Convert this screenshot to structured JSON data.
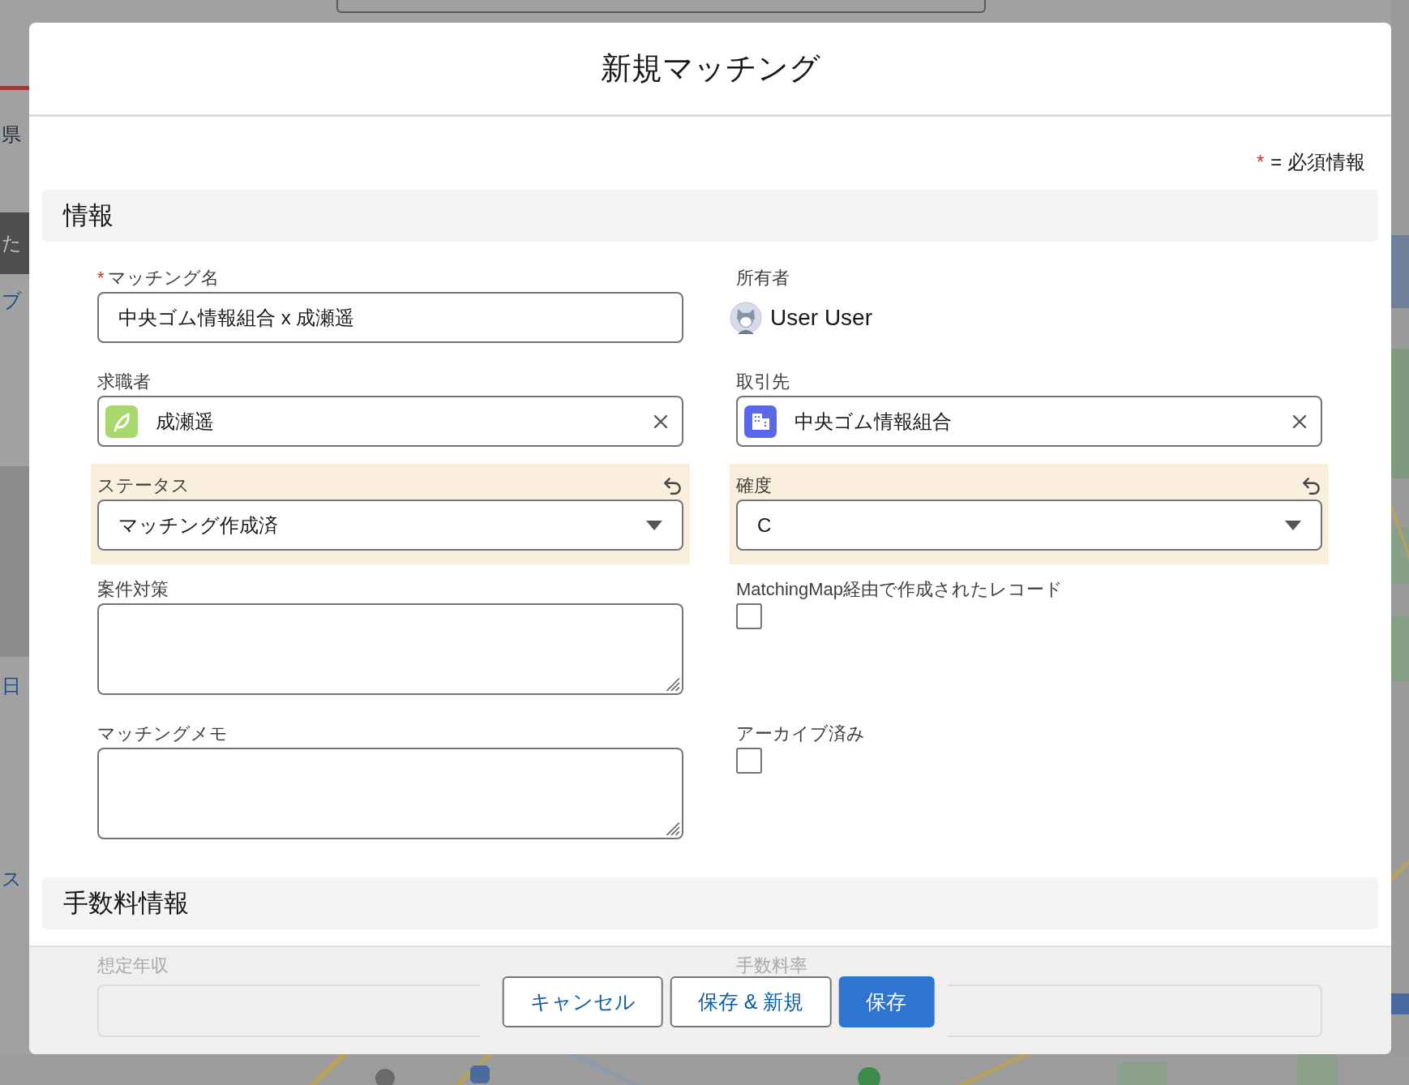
{
  "background": {
    "side_texts": [
      {
        "text": "県",
        "kind": "plain"
      },
      {
        "text": "た",
        "kind": "tab"
      },
      {
        "text": "ブ",
        "kind": "link"
      },
      {
        "text": "日",
        "kind": "link"
      },
      {
        "text": "ス",
        "kind": "link"
      }
    ]
  },
  "dialog": {
    "title": "新規マッチング",
    "required_note": {
      "mark": "*",
      "text": "= 必須情報"
    }
  },
  "sections": [
    {
      "title": "情報",
      "fields": [
        {
          "kind": "text",
          "label": "マッチング名",
          "required": true,
          "changed": false,
          "value": "中央ゴム情報組合 x 成瀬遥"
        },
        {
          "kind": "owner",
          "label": "所有者",
          "required": false,
          "changed": false,
          "value": "User User"
        },
        {
          "kind": "lookup",
          "label": "求職者",
          "required": false,
          "changed": false,
          "value": "成瀬遥",
          "color": "#a9d86e"
        },
        {
          "kind": "lookup",
          "label": "取引先",
          "required": false,
          "changed": false,
          "value": "中央ゴム情報組合",
          "color": "#5a67e6"
        },
        {
          "kind": "picklist",
          "label": "ステータス",
          "required": false,
          "changed": true,
          "value": "マッチング作成済"
        },
        {
          "kind": "picklist",
          "label": "確度",
          "required": false,
          "changed": true,
          "value": "C"
        },
        {
          "kind": "textarea",
          "label": "案件対策",
          "required": false,
          "changed": false
        },
        {
          "kind": "checkbox",
          "label": "MatchingMap経由で作成されたレコード",
          "required": false,
          "changed": false,
          "checked": false
        },
        {
          "kind": "textarea",
          "label": "マッチングメモ",
          "required": false,
          "changed": false
        },
        {
          "kind": "checkbox",
          "label": "アーカイブ済み",
          "required": false,
          "changed": false,
          "checked": false
        }
      ]
    },
    {
      "title": "手数料情報",
      "fields": [
        {
          "kind": "text",
          "label": "想定年収"
        },
        {
          "kind": "text",
          "label": "手数料率"
        }
      ]
    }
  ],
  "buttons": [
    {
      "label": "キャンセル",
      "kind": "neutral"
    },
    {
      "label": "保存 & 新規",
      "kind": "neutral"
    },
    {
      "label": "保存",
      "kind": "brand"
    }
  ]
}
